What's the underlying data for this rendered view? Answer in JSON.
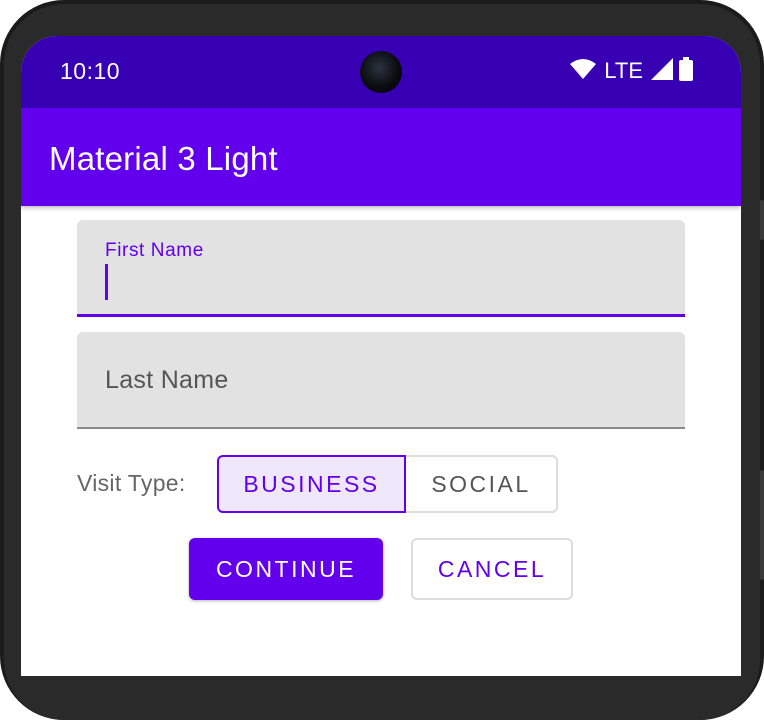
{
  "status_bar": {
    "time": "10:10",
    "network_label": "LTE",
    "icons": [
      "wifi-icon",
      "signal-icon",
      "battery-icon"
    ]
  },
  "app_bar": {
    "title": "Material 3 Light"
  },
  "form": {
    "first_name": {
      "label": "First Name",
      "value": ""
    },
    "last_name": {
      "placeholder": "Last Name",
      "value": ""
    },
    "visit_type": {
      "label": "Visit Type:",
      "options": [
        "BUSINESS",
        "SOCIAL"
      ],
      "selected": "BUSINESS"
    },
    "continue_label": "CONTINUE",
    "cancel_label": "CANCEL"
  },
  "colors": {
    "primary": "#6200ee",
    "status_bar": "#3700b3",
    "field_background": "#e2e2e2",
    "selected_toggle_background": "#efe7fb"
  }
}
